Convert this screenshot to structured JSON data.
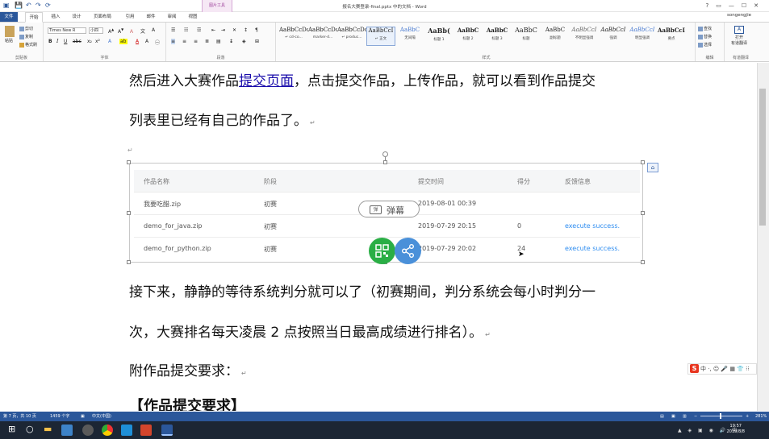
{
  "window": {
    "title": "报名大赛登录-final.pptx 中的文档 - Word",
    "qat": [
      "💾",
      "↶",
      "↷",
      "⟳"
    ],
    "controls": [
      "?",
      "▭",
      "—",
      "☐",
      "✕"
    ],
    "user": "songengjie"
  },
  "ribbon_tabs": [
    "文件",
    "开始",
    "插入",
    "设计",
    "页面布局",
    "引用",
    "邮件",
    "审阅",
    "视图",
    "格式"
  ],
  "context_tab_group": "图片工具",
  "clipboard": {
    "paste": "粘贴",
    "cut": "剪切",
    "copy": "复制",
    "format_painter": "格式刷",
    "label": "剪贴板"
  },
  "font": {
    "name": "Times New R",
    "size": "小四",
    "label": "字体"
  },
  "paragraph": {
    "label": "段落"
  },
  "styles": {
    "label": "样式",
    "items": [
      {
        "preview": "AaBbCcDc",
        "name": "↵ cd-co..."
      },
      {
        "preview": "AaBbCcDc",
        "name": "marker-d..."
      },
      {
        "preview": "AaBbCcDc",
        "name": "↵ produc..."
      },
      {
        "preview": "AaBbCcI",
        "name": "↵ 正文"
      },
      {
        "preview": "AaBbC",
        "name": "无间隔"
      },
      {
        "preview": "AaBb(",
        "name": "标题 1"
      },
      {
        "preview": "AaBbC",
        "name": "标题 2"
      },
      {
        "preview": "AaBbC",
        "name": "标题 3"
      },
      {
        "preview": "AaBbC",
        "name": "标题"
      },
      {
        "preview": "AaBbC",
        "name": "副标题"
      },
      {
        "preview": "AaBbCcI",
        "name": "不明显强调"
      },
      {
        "preview": "AaBbCcI",
        "name": "强调"
      },
      {
        "preview": "AaBbCcI",
        "name": "明显强调"
      },
      {
        "preview": "AaBbCcI",
        "name": "要点"
      },
      {
        "preview": "AaBbCcL",
        "name": "不明显参考"
      }
    ]
  },
  "editing": {
    "find": "查找",
    "replace": "替换",
    "select": "选择",
    "label": "编辑"
  },
  "translate": {
    "open": "打开",
    "tool": "有道翻译",
    "label": "有道翻译"
  },
  "document": {
    "para1_before": "然后进入大赛作品",
    "para1_link": "提交页面",
    "para1_after": "，点击提交作品，上传作品，就可以看到作品提交",
    "para2": "列表里已经有自己的作品了。",
    "para3": "接下来，静静的等待系统判分就可以了（初赛期间，判分系统会每小时判分一",
    "para4": "次，大赛排名每天凌晨 2 点按照当日最高成绩进行排名）。",
    "para5": "附作品提交要求：",
    "heading": "【作品提交要求】",
    "para_mark": "↵"
  },
  "submission_table": {
    "headers": [
      "作品名称",
      "阶段",
      "提交时间",
      "得分",
      "反馈信息"
    ],
    "rows": [
      {
        "name": "我要吃醋.zip",
        "stage": "初赛",
        "time": "2019-08-01 00:39",
        "score": "",
        "feedback": ""
      },
      {
        "name": "demo_for_java.zip",
        "stage": "初赛",
        "time": "2019-07-29 20:15",
        "score": "0",
        "feedback": "execute success."
      },
      {
        "name": "demo_for_python.zip",
        "stage": "初赛",
        "time": "2019-07-29 20:02",
        "score": "24",
        "feedback": "execute success."
      }
    ]
  },
  "overlay": {
    "danmu_label": "弹幕",
    "danmu_icon": "弹"
  },
  "ime": {
    "logo": "S",
    "text": "中 ·, ☺ 🎤 ▦ 👕 ⁝⁝"
  },
  "statusbar": {
    "page": "第 7 页，共 10 页",
    "words": "1459 个字",
    "lang": "中文(中国)",
    "zoom": "281%",
    "zoom_level": 0.48
  },
  "taskbar": {
    "time": "19:57",
    "date": "2019/8/8"
  }
}
